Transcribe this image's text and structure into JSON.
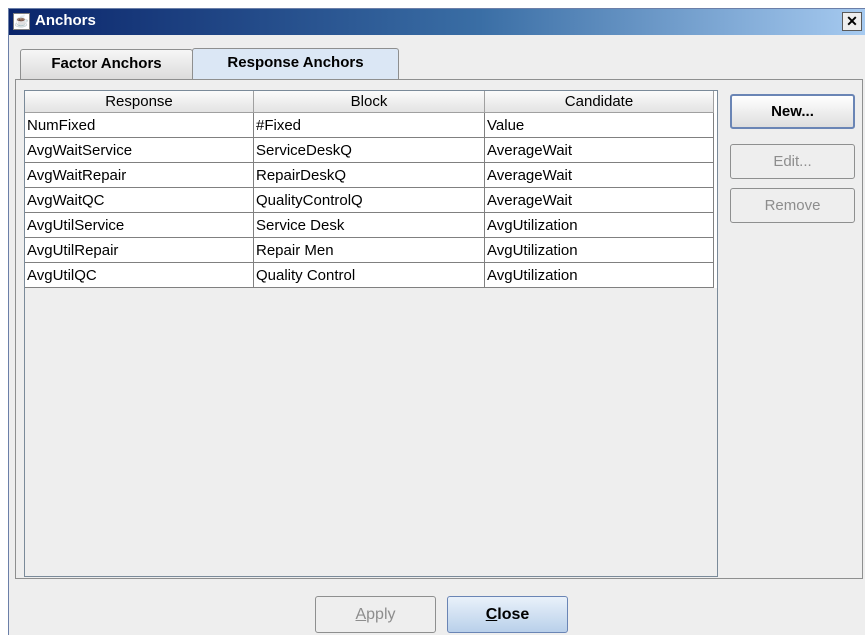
{
  "window": {
    "title": "Anchors",
    "close_glyph": "✕",
    "app_icon": "java-cup-icon"
  },
  "tabs": [
    {
      "label": "Factor Anchors",
      "selected": false
    },
    {
      "label": "Response Anchors",
      "selected": true
    }
  ],
  "table": {
    "headers": [
      "Response",
      "Block",
      "Candidate"
    ],
    "rows": [
      [
        "NumFixed",
        "#Fixed",
        "Value"
      ],
      [
        "AvgWaitService",
        "ServiceDeskQ",
        "AverageWait"
      ],
      [
        "AvgWaitRepair",
        "RepairDeskQ",
        "AverageWait"
      ],
      [
        "AvgWaitQC",
        "QualityControlQ",
        "AverageWait"
      ],
      [
        "AvgUtilService",
        "Service Desk",
        "AvgUtilization"
      ],
      [
        "AvgUtilRepair",
        "Repair Men",
        "AvgUtilization"
      ],
      [
        "AvgUtilQC",
        "Quality Control",
        "AvgUtilization"
      ]
    ]
  },
  "side_buttons": {
    "new": "New...",
    "edit": "Edit...",
    "remove": "Remove"
  },
  "footer": {
    "apply_mnemonic": "A",
    "apply_rest": "pply",
    "close_mnemonic": "C",
    "close_rest": "lose"
  },
  "colors": {
    "title_bar": "#0a246a",
    "selected_tab": "#dbe7f5",
    "disabled_text": "#8d8d8d"
  }
}
